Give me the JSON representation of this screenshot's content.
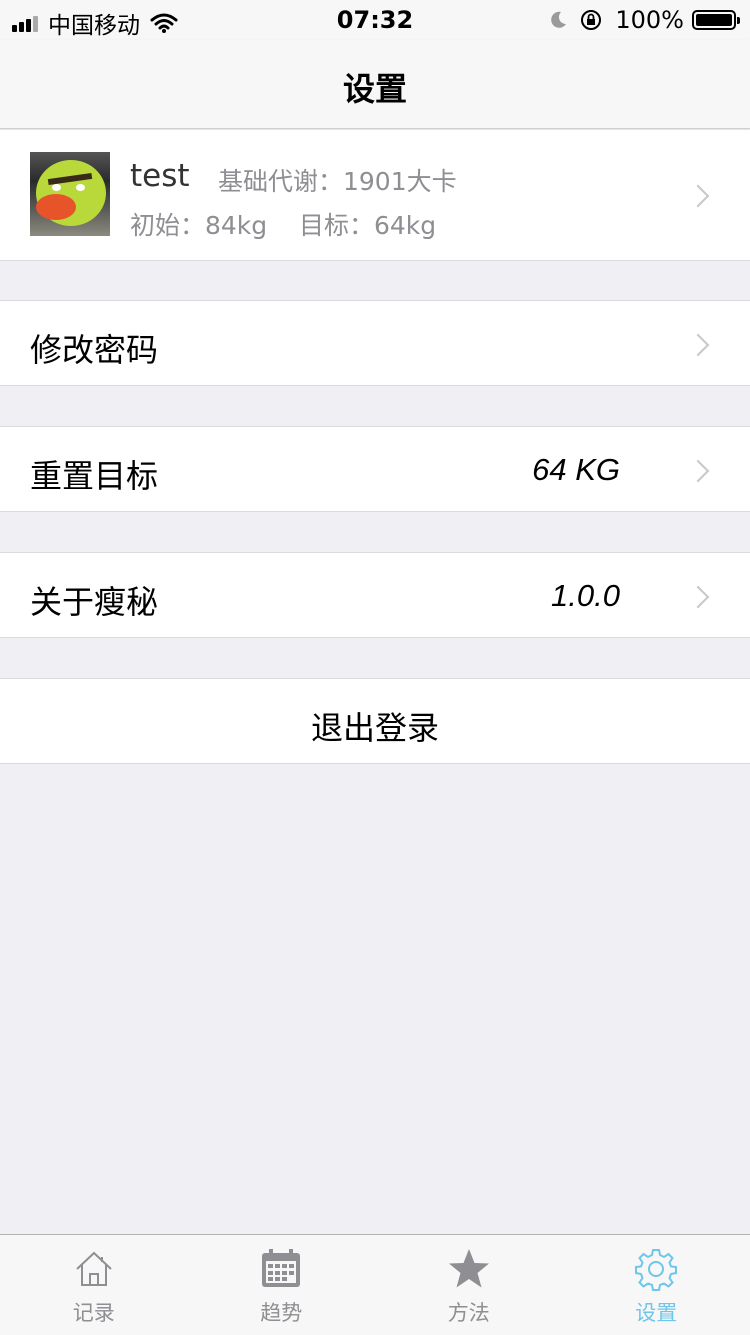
{
  "status_bar": {
    "carrier": "中国移动",
    "time": "07:32",
    "battery": "100%",
    "icons": [
      "signal-icon",
      "wifi-icon",
      "moon-icon",
      "rotation-lock-icon",
      "battery-icon"
    ]
  },
  "nav": {
    "title": "设置"
  },
  "profile": {
    "name": "test",
    "bmr": "基础代谢：1901大卡",
    "weights": "初始：84kg    目标：64kg"
  },
  "rows": {
    "change_password": "修改密码",
    "reset_goal": "重置目标",
    "reset_goal_value": "64 KG",
    "about": "关于瘦秘",
    "about_value": "1.0.0",
    "logout": "退出登录"
  },
  "tabs": [
    {
      "label": "记录",
      "icon": "home-icon"
    },
    {
      "label": "趋势",
      "icon": "calendar-icon"
    },
    {
      "label": "方法",
      "icon": "star-icon"
    },
    {
      "label": "设置",
      "icon": "gear-icon",
      "active": true
    }
  ],
  "colors": {
    "accent": "#6ec6ea",
    "inactive": "#8e8e93",
    "background": "#efeff4"
  }
}
